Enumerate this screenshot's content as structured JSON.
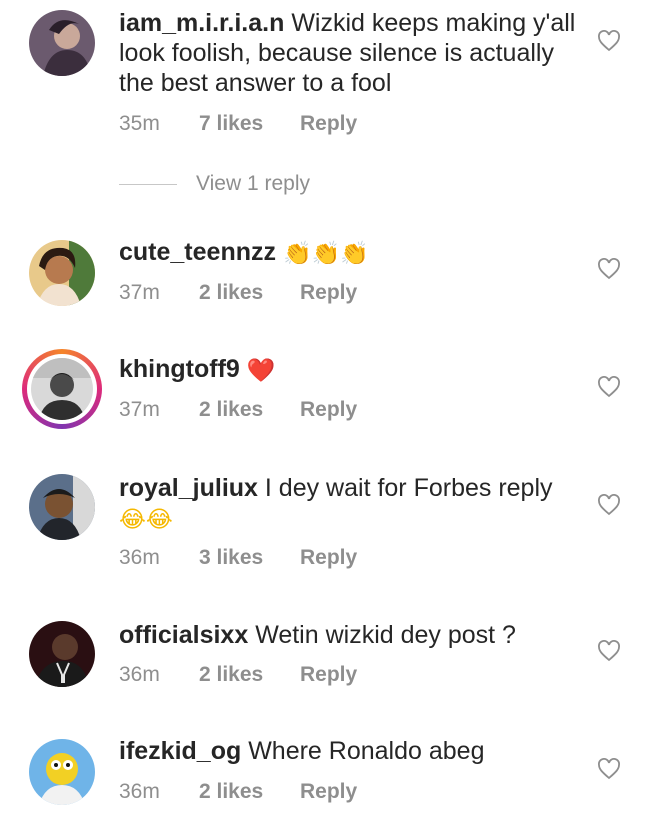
{
  "comments": [
    {
      "username": "iam_m.i.r.i.a.n",
      "text": "Wizkid keeps making y'all look foolish, because silence is actually the best answer to a fool",
      "emoji": "",
      "time": "35m",
      "likes": "7 likes",
      "reply_label": "Reply",
      "avatar_icon": "profile-photo"
    },
    {
      "username": "cute_teennzz",
      "text": "",
      "emoji": "👏👏👏",
      "time": "37m",
      "likes": "2 likes",
      "reply_label": "Reply",
      "avatar_icon": "profile-photo"
    },
    {
      "username": "khingtoff9",
      "text": "",
      "emoji": "❤️",
      "time": "37m",
      "likes": "2 likes",
      "reply_label": "Reply",
      "avatar_icon": "profile-photo-story-ring"
    },
    {
      "username": "royal_juliux",
      "text": "I dey wait for Forbes reply",
      "emoji": "😂😂",
      "time": "36m",
      "likes": "3 likes",
      "reply_label": "Reply",
      "avatar_icon": "profile-photo"
    },
    {
      "username": "officialsixx",
      "text": "Wetin wizkid dey post ?",
      "emoji": "",
      "time": "36m",
      "likes": "2 likes",
      "reply_label": "Reply",
      "avatar_icon": "profile-photo"
    },
    {
      "username": "ifezkid_og",
      "text": "Where Ronaldo abeg",
      "emoji": "",
      "time": "36m",
      "likes": "2 likes",
      "reply_label": "Reply",
      "avatar_icon": "profile-photo"
    }
  ],
  "view_replies_label": "View 1 reply",
  "colors": {
    "text": "#262626",
    "muted": "#8e8e8e",
    "story_ring": "#dd2a7b",
    "heart_emoji": "#e0245e"
  }
}
